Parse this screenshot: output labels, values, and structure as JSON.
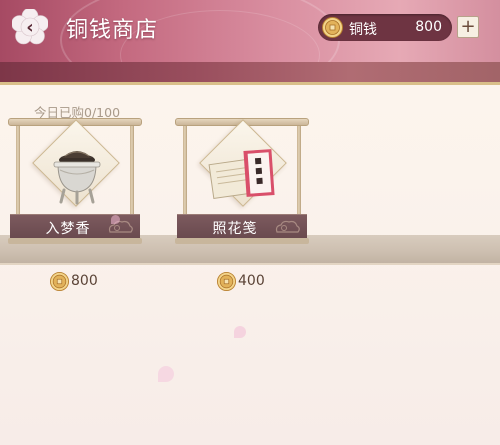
{
  "header": {
    "title": "铜钱商店",
    "currency_name": "铜钱",
    "currency_amount": "800",
    "add_label": "+"
  },
  "shop": {
    "purchase_count": "今日已购0/100",
    "items": [
      {
        "name": "入梦香",
        "price": "800",
        "icon": "incense-burner-icon"
      },
      {
        "name": "照花笺",
        "price": "400",
        "icon": "letter-paper-icon"
      }
    ]
  },
  "colors": {
    "header_pink": "#c46a80",
    "pill_dark": "#6e3442",
    "label_bar": "#7c5a5e",
    "coin_gold": "#d9a54a"
  }
}
